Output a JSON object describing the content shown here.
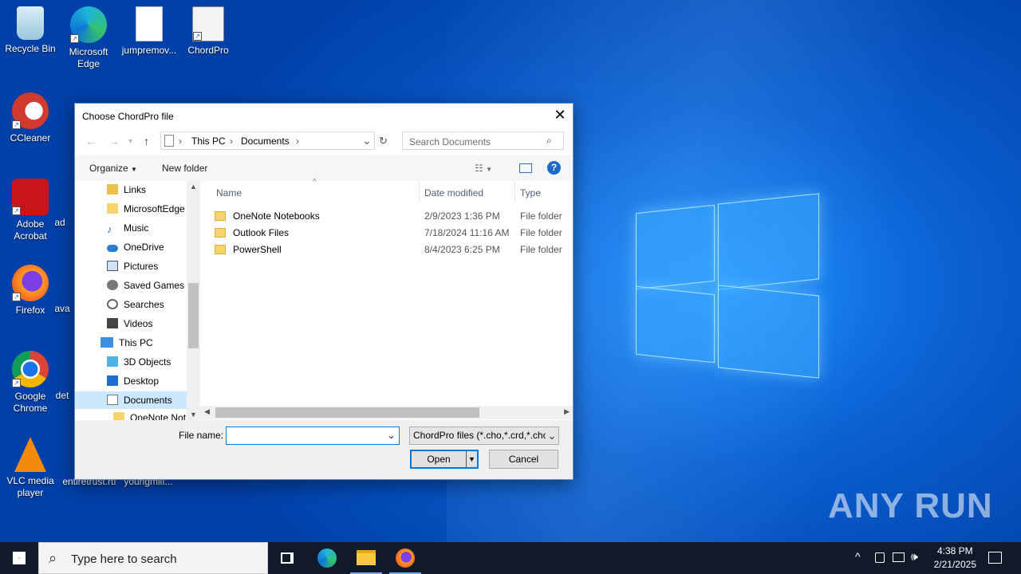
{
  "desktop": {
    "icons": [
      {
        "label": "Recycle Bin",
        "icon": "recycle-bin-icon"
      },
      {
        "label": "Microsoft Edge",
        "icon": "edge-icon"
      },
      {
        "label": "jumpremov...",
        "icon": "image-file-icon"
      },
      {
        "label": "ChordPro",
        "icon": "chordpro-icon"
      },
      {
        "label": "CCleaner",
        "icon": "ccleaner-icon"
      },
      {
        "label": "Adobe Acrobat",
        "icon": "acrobat-icon"
      },
      {
        "label": "ad",
        "icon": "file-icon"
      },
      {
        "label": "Firefox",
        "icon": "firefox-icon"
      },
      {
        "label": "ava",
        "icon": "file-icon"
      },
      {
        "label": "Google Chrome",
        "icon": "chrome-icon"
      },
      {
        "label": "det",
        "icon": "file-icon"
      },
      {
        "label": "VLC media player",
        "icon": "vlc-icon"
      },
      {
        "label": "entiretrust.rtf",
        "icon": "rtf-file-icon"
      },
      {
        "label": "youngmilf...",
        "icon": "file-icon"
      }
    ],
    "watermark": "ANY RUN"
  },
  "dialog": {
    "title": "Choose ChordPro file",
    "close": "✕",
    "nav": {
      "back": "←",
      "forward": "→",
      "recent": "▾",
      "up": "↑"
    },
    "breadcrumb": [
      "This PC",
      "Documents"
    ],
    "search_placeholder": "Search Documents",
    "toolbar": {
      "organize": "Organize",
      "new_folder": "New folder",
      "help": "?"
    },
    "tree": [
      {
        "label": "Links",
        "icon": "links-icon"
      },
      {
        "label": "MicrosoftEdge",
        "icon": "folder-icon"
      },
      {
        "label": "Music",
        "icon": "music-icon"
      },
      {
        "label": "OneDrive",
        "icon": "onedrive-icon"
      },
      {
        "label": "Pictures",
        "icon": "pictures-icon"
      },
      {
        "label": "Saved Games",
        "icon": "saved-games-icon"
      },
      {
        "label": "Searches",
        "icon": "search-icon"
      },
      {
        "label": "Videos",
        "icon": "videos-icon"
      },
      {
        "label": "This PC",
        "icon": "computer-icon"
      },
      {
        "label": "3D Objects",
        "icon": "3d-objects-icon"
      },
      {
        "label": "Desktop",
        "icon": "desktop-icon"
      },
      {
        "label": "Documents",
        "icon": "documents-icon"
      },
      {
        "label": "OneNote Not",
        "icon": "folder-icon"
      }
    ],
    "columns": {
      "name": "Name",
      "date": "Date modified",
      "type": "Type"
    },
    "files": [
      {
        "name": "OneNote Notebooks",
        "date": "2/9/2023 1:36 PM",
        "type": "File folder"
      },
      {
        "name": "Outlook Files",
        "date": "7/18/2024 11:16 AM",
        "type": "File folder"
      },
      {
        "name": "PowerShell",
        "date": "8/4/2023 6:25 PM",
        "type": "File folder"
      }
    ],
    "file_name_label": "File name:",
    "file_name_value": "",
    "filter": "ChordPro files (*.cho,*.crd,*.chopro)",
    "open": "Open",
    "cancel": "Cancel"
  },
  "taskbar": {
    "search_placeholder": "Type here to search",
    "time": "4:38 PM",
    "date": "2/21/2025"
  }
}
